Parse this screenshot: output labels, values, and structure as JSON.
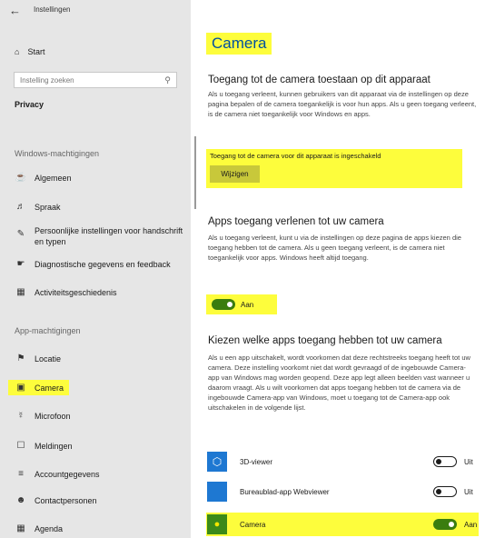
{
  "window": {
    "title": "Instellingen"
  },
  "sidebar": {
    "home": "Start",
    "search": {
      "placeholder": "Instelling zoeken"
    },
    "section": "Privacy",
    "group1": "Windows-machtigingen",
    "group2": "App-machtigingen",
    "items": [
      {
        "label": "Algemeen",
        "icon": "lock-icon"
      },
      {
        "label": "Spraak",
        "icon": "speech-icon"
      },
      {
        "label": "Persoonlijke instellingen voor handschrift en typen",
        "icon": "pen-icon"
      },
      {
        "label": "Diagnostische gegevens en feedback",
        "icon": "feedback-icon"
      },
      {
        "label": "Activiteitsgeschiedenis",
        "icon": "timeline-icon"
      },
      {
        "label": "Locatie",
        "icon": "location-icon"
      },
      {
        "label": "Camera",
        "icon": "camera-icon",
        "selected": true
      },
      {
        "label": "Microfoon",
        "icon": "microphone-icon"
      },
      {
        "label": "Meldingen",
        "icon": "notifications-icon"
      },
      {
        "label": "Accountgegevens",
        "icon": "account-info-icon"
      },
      {
        "label": "Contactpersonen",
        "icon": "contacts-icon"
      },
      {
        "label": "Agenda",
        "icon": "calendar-icon"
      }
    ]
  },
  "main": {
    "title": "Camera",
    "device": {
      "heading": "Toegang tot de camera toestaan op dit apparaat",
      "description": "Als u toegang verleent, kunnen gebruikers van dit apparaat via de instellingen op deze pagina bepalen of de camera toegankelijk is voor hun apps. Als u geen toegang verleent, is de camera niet toegankelijk voor Windows en apps.",
      "status": "Toegang tot de camera voor dit apparaat is ingeschakeld",
      "button": "Wijzigen"
    },
    "apps_access": {
      "heading": "Apps toegang verlenen tot uw camera",
      "description": "Als u toegang verleent, kunt u via de instellingen op deze pagina de apps kiezen die toegang hebben tot de camera. Als u geen toegang verleent, is de camera niet toegankelijk voor apps. Windows heeft altijd toegang.",
      "toggle_label": "Aan",
      "toggle_on": true
    },
    "choose_apps": {
      "heading": "Kiezen welke apps toegang hebben tot uw camera",
      "description": "Als u een app uitschakelt, wordt voorkomen dat deze rechtstreeks toegang heeft tot uw camera. Deze instelling voorkomt niet dat wordt gevraagd of de ingebouwde Camera-app van Windows mag worden geopend. Deze app legt alleen beelden vast wanneer u daarom vraagt. Als u wilt voorkomen dat apps toegang hebben tot de camera via de ingebouwde Camera-app van Windows, moet u toegang tot de Camera-app ook uitschakelen in de volgende lijst.",
      "apps": [
        {
          "name": "3D-viewer",
          "state": "Uit",
          "on": false,
          "icon": "cube-icon"
        },
        {
          "name": "Bureaublad-app Webviewer",
          "state": "Uit",
          "on": false,
          "icon": "app-tile-icon"
        },
        {
          "name": "Camera",
          "state": "Aan",
          "on": true,
          "icon": "camera-app-icon"
        }
      ]
    }
  },
  "colors": {
    "highlight": "#fdfd3c",
    "accent": "#0050a0",
    "toggle_on": "#3a7d0f",
    "app_tile": "#1e78d2"
  }
}
